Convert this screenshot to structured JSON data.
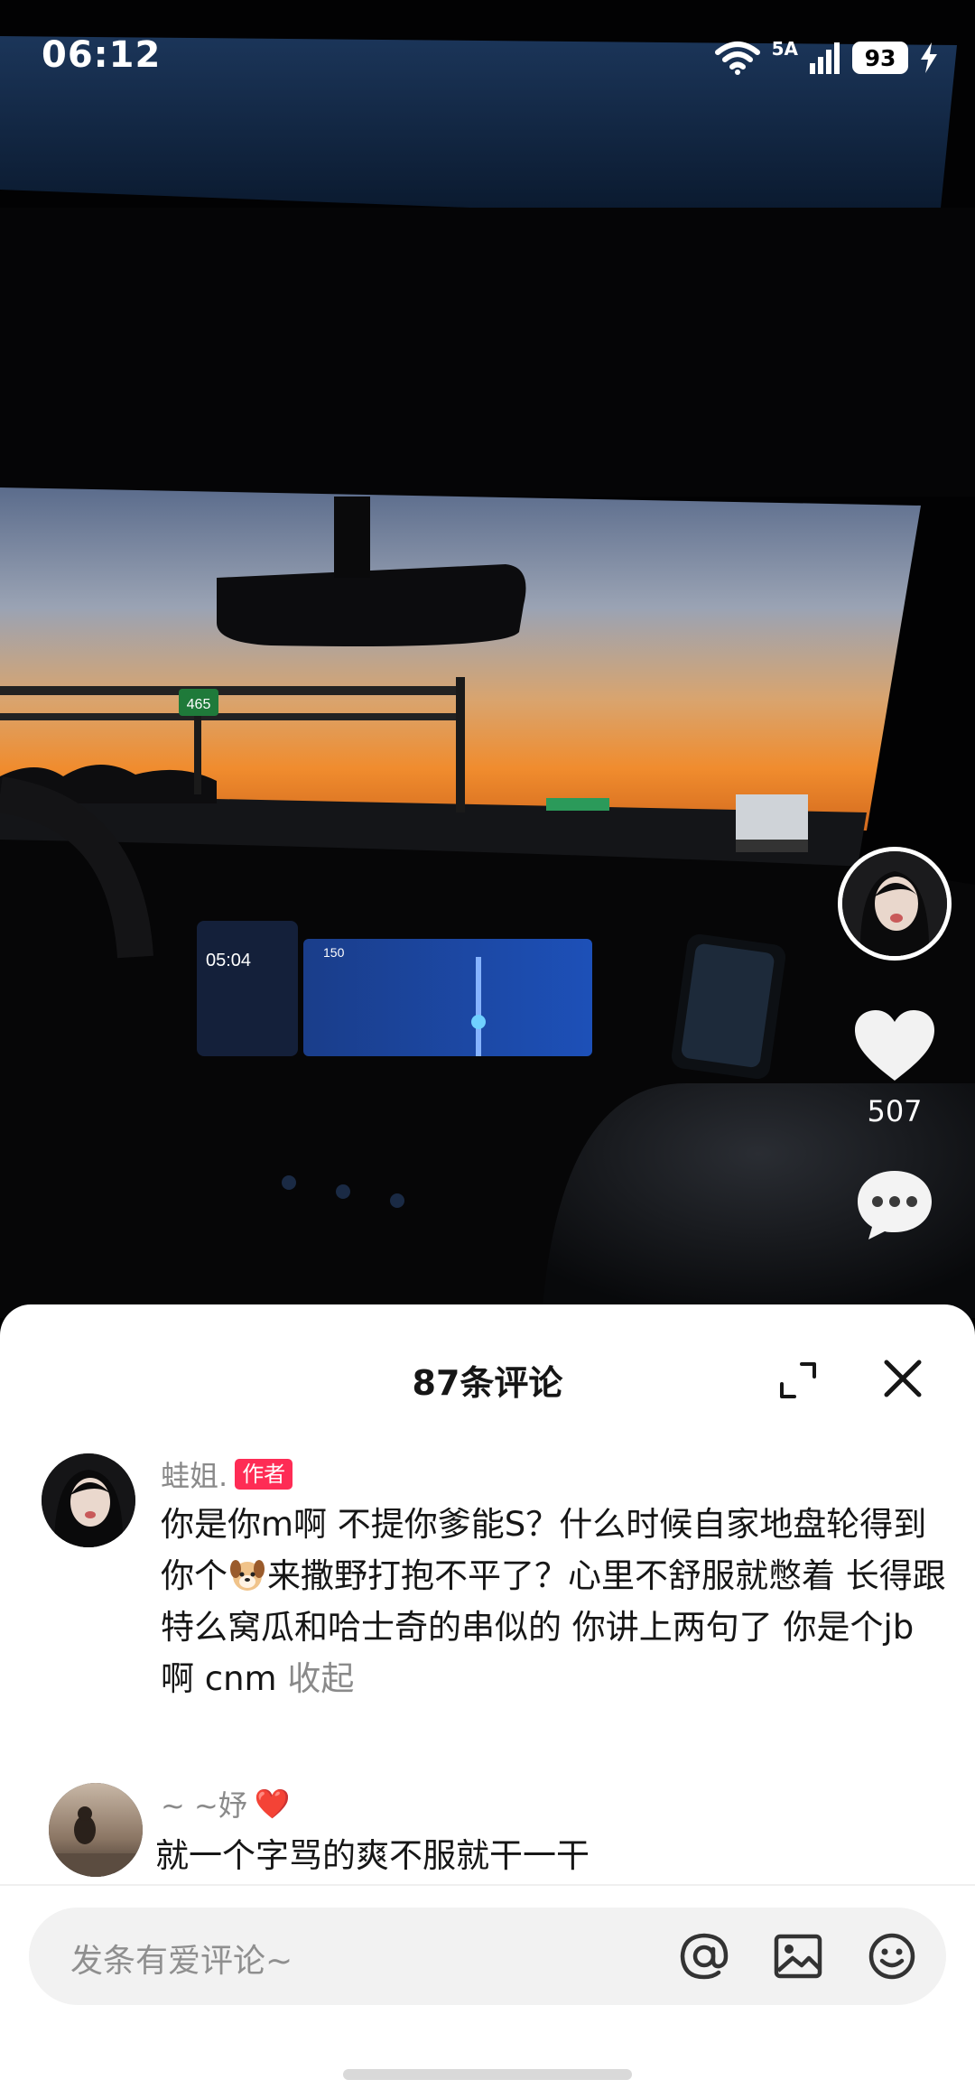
{
  "status_bar": {
    "time": "06:12",
    "network": "5A",
    "battery": "93"
  },
  "video": {
    "sign_text": "465",
    "dash_clock": "05:04",
    "nav_distance": "150"
  },
  "side_actions": {
    "like_count": "507"
  },
  "comments_panel": {
    "title": "87条评论",
    "input_placeholder": "发条有爱评论~",
    "comments": [
      {
        "user": "蛙姐.",
        "tag": "作者",
        "text_before_emoji": "你是你m啊 不提你爹能S？什么时候自家地盘轮得到你个",
        "text_after_emoji": "来撒野打抱不平了？心里不舒服就憋着 长得跟特么窝瓜和哈士奇的串似的 你讲上两句了 你是个jb啊 cnm",
        "collapse_label": "收起"
      },
      {
        "user": "~ ~妤",
        "heart": "❤️",
        "text": "就一个字骂的爽不服就干一干"
      }
    ]
  },
  "colors": {
    "author_tag": "#fe2c55",
    "sheet_bg": "#ffffff",
    "muted_text": "#8a8a8a"
  },
  "icons": [
    "wifi-icon",
    "signal-icon",
    "charging-icon",
    "heart-icon",
    "comment-bubble-icon",
    "expand-icon",
    "close-icon",
    "at-icon",
    "image-icon",
    "emoji-icon",
    "dog-emoji-icon"
  ]
}
